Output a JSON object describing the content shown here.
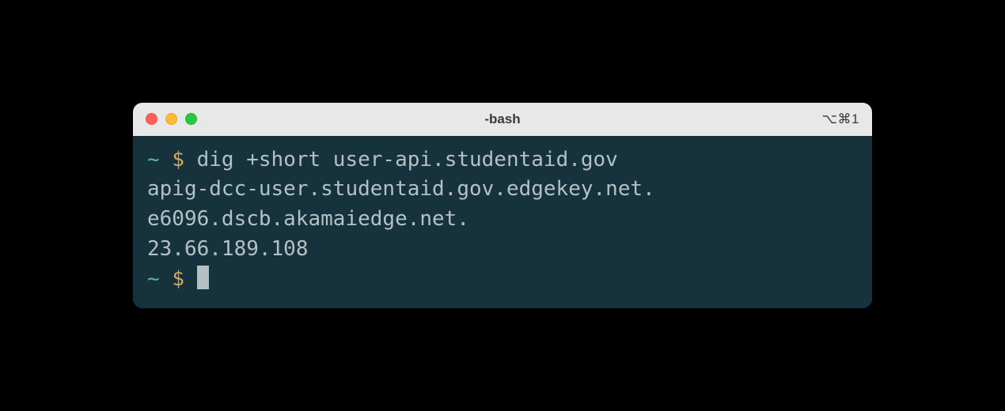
{
  "window": {
    "title": "-bash",
    "tab_indicator": "⌥⌘1"
  },
  "prompt": {
    "tilde": "~",
    "dollar": "$"
  },
  "terminal": {
    "command": "dig +short user-api.studentaid.gov",
    "output": [
      "apig-dcc-user.studentaid.gov.edgekey.net.",
      "e6096.dscb.akamaiedge.net.",
      "23.66.189.108"
    ]
  }
}
